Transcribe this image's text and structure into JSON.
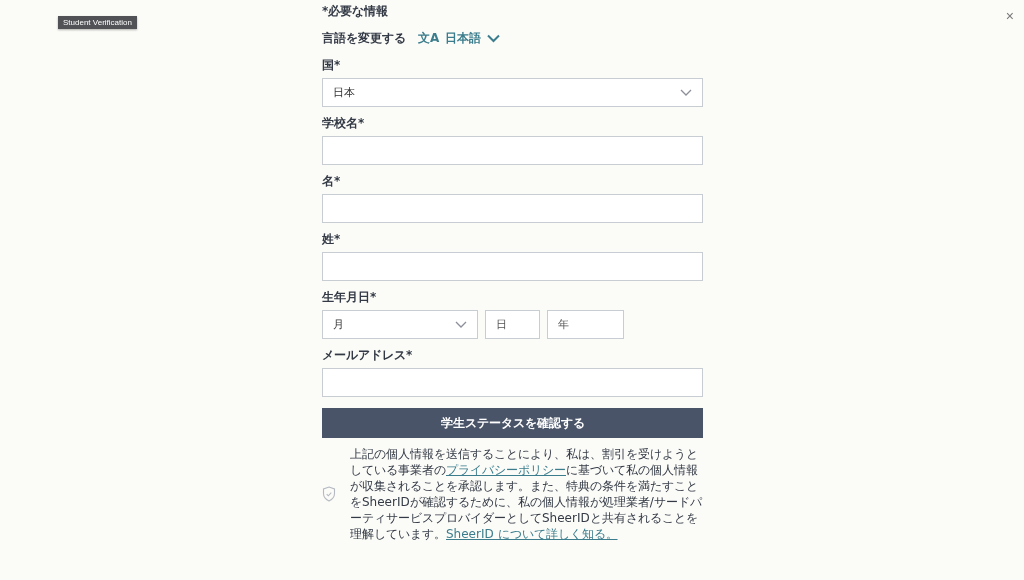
{
  "tooltip": "Student Verification",
  "close": "×",
  "required_note": "*必要な情報",
  "language": {
    "label": "言語を変更する",
    "icon": "文A",
    "value": "日本語"
  },
  "fields": [
    {
      "kind": "select",
      "label": "国*",
      "value": "日本"
    },
    {
      "kind": "text",
      "label": "学校名*"
    },
    {
      "kind": "text",
      "label": "名*"
    },
    {
      "kind": "text",
      "label": "姓*"
    },
    {
      "kind": "date",
      "label": "生年月日*",
      "parts": [
        {
          "kind": "select",
          "placeholder": "月"
        },
        {
          "kind": "text",
          "placeholder": "日"
        },
        {
          "kind": "text",
          "placeholder": "年"
        }
      ]
    },
    {
      "kind": "text",
      "label": "メールアドレス*"
    }
  ],
  "submit": "学生ステータスを確認する",
  "privacy": [
    {
      "kind": "text",
      "text": "上記の個人情報を送信することにより、私は、割引を受けようとしている事業者の"
    },
    {
      "kind": "link",
      "text": "プライバシーポリシー"
    },
    {
      "kind": "text",
      "text": "に基づいて私の個人情報が収集されることを承認します。また、特典の条件を満たすことをSheerIDが確認するために、私の個人情報が処理業者/サードパーティサービスプロバイダーとしてSheerIDと共有されることを理解しています。"
    },
    {
      "kind": "link",
      "text": "SheerID について詳しく知る。"
    }
  ]
}
